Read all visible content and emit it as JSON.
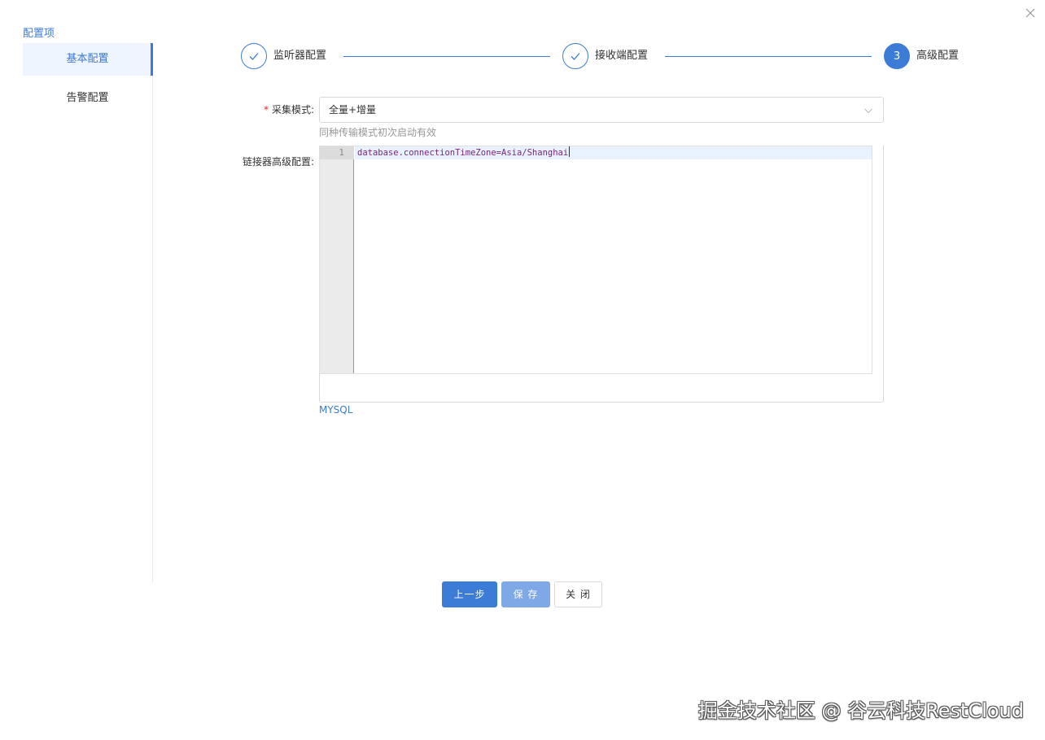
{
  "sidebar": {
    "title": "配置项",
    "items": [
      {
        "label": "基本配置",
        "active": true
      },
      {
        "label": "告警配置",
        "active": false
      }
    ]
  },
  "steps": [
    {
      "label": "监听器配置",
      "status": "finished",
      "icon": "check-icon"
    },
    {
      "label": "接收端配置",
      "status": "finished",
      "icon": "check-icon"
    },
    {
      "label": "高级配置",
      "status": "current",
      "number": "3"
    }
  ],
  "form": {
    "collect_mode": {
      "label": "采集模式:",
      "required_mark": "*",
      "value": "全量+增量",
      "help": "同种传输模式初次启动有效"
    },
    "advanced": {
      "label": "链接器高级配置:",
      "editor": {
        "line_numbers": [
          "1"
        ],
        "lines": [
          "database.connectionTimeZone=Asia/Shanghai"
        ]
      },
      "language": "MYSQL"
    }
  },
  "buttons": {
    "prev": "上一步",
    "save": "保 存",
    "close": "关 闭"
  },
  "watermark": "掘金技术社区 @ 谷云科技RestCloud",
  "colors": {
    "accent": "#3c7bd6",
    "required": "#f5222d",
    "save_button": "#7fa8e6"
  }
}
